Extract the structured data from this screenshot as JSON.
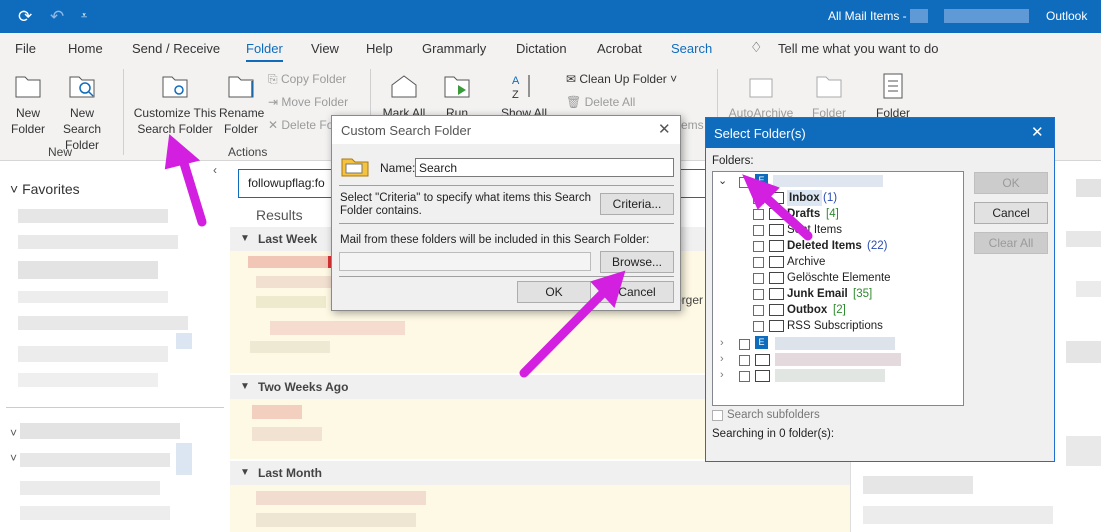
{
  "titlebar": {
    "title": "All Mail Items -",
    "app": "Outlook"
  },
  "tabs": [
    "File",
    "Home",
    "Send / Receive",
    "Folder",
    "View",
    "Help",
    "Grammarly",
    "Dictation",
    "Acrobat",
    "Search"
  ],
  "tell_me": "Tell me what you want to do",
  "ribbon": {
    "new_folder": [
      "New",
      "Folder"
    ],
    "new_search_folder": [
      "New Search",
      "Folder"
    ],
    "group_new": "New",
    "customize": [
      "Customize This",
      "Search Folder"
    ],
    "rename": [
      "Rename",
      "Folder"
    ],
    "copy_folder": "Copy Folder",
    "move_folder": "Move Folder",
    "delete_folder": "Delete Fo",
    "group_actions": "Actions",
    "mark_all": "Mark All",
    "run_rules": "Run Rules",
    "show_all": "Show All",
    "clean_up": "Clean Up Folder",
    "delete_all": "Delete All",
    "items": "ems",
    "auto_archive": "AutoArchive",
    "folder_btn": "Folder",
    "folder_btn2": "Folder"
  },
  "nav": {
    "favorites": "Favorites"
  },
  "list": {
    "search_text": "followupflag:fo",
    "results": "Results",
    "groups": [
      "Last Week",
      "Two Weeks Ago",
      "Last Month"
    ],
    "fragment": "orger"
  },
  "custom_dialog": {
    "title": "Custom Search Folder",
    "name_label": "Name:",
    "name_value": "Search",
    "criteria_text": "Select \"Criteria\" to specify what items this Search Folder contains.",
    "criteria_button": "Criteria...",
    "mail_from_text": "Mail from these folders will be included in this Search Folder:",
    "browse_button": "Browse...",
    "ok_button": "OK",
    "cancel_button": "Cancel"
  },
  "select_dialog": {
    "title": "Select Folder(s)",
    "folders_label": "Folders:",
    "ok_button": "OK",
    "cancel_button": "Cancel",
    "clear_all_button": "Clear All",
    "search_subfolders": "Search subfolders",
    "status": "Searching in 0 folder(s):",
    "folders": [
      {
        "name": "Inbox",
        "count": "(1)",
        "bold": true,
        "count_color": "blue"
      },
      {
        "name": "Drafts",
        "count": "[4]",
        "bold": true,
        "count_color": "green"
      },
      {
        "name": "Sent Items",
        "count": "",
        "bold": false
      },
      {
        "name": "Deleted Items",
        "count": "(22)",
        "bold": true,
        "count_color": "blue"
      },
      {
        "name": "Archive",
        "count": "",
        "bold": false
      },
      {
        "name": "Gelöschte Elemente",
        "count": "",
        "bold": false
      },
      {
        "name": "Junk Email",
        "count": "[35]",
        "bold": true,
        "count_color": "green"
      },
      {
        "name": "Outbox",
        "count": "[2]",
        "bold": true,
        "count_color": "green"
      },
      {
        "name": "RSS Subscriptions",
        "count": "",
        "bold": false
      }
    ]
  },
  "colors": {
    "accent": "#0f6cbd",
    "annotation_arrow": "#d21fe0"
  }
}
